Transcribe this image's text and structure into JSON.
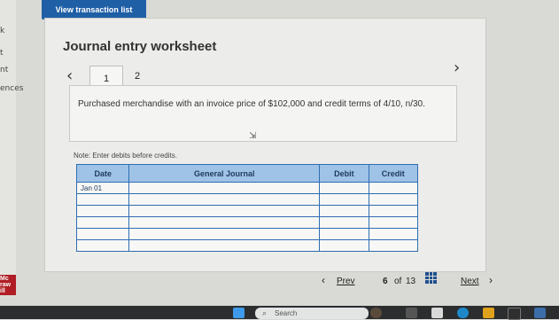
{
  "left_strip": {
    "items": [
      "k",
      "t",
      "nt",
      "ences"
    ]
  },
  "header": {
    "view_transaction_label": "View transaction list"
  },
  "worksheet": {
    "title": "Journal entry worksheet",
    "tabs": [
      {
        "label": "1",
        "active": true
      },
      {
        "label": "2",
        "active": false
      }
    ],
    "prompt": "Purchased merchandise with an invoice price of $102,000 and credit terms of 4/10, n/30.",
    "note": "Note: Enter debits before credits."
  },
  "journal_table": {
    "columns": [
      "Date",
      "General Journal",
      "Debit",
      "Credit"
    ],
    "rows": [
      [
        "Jan 01",
        "",
        "",
        ""
      ],
      [
        "",
        "",
        "",
        ""
      ],
      [
        "",
        "",
        "",
        ""
      ],
      [
        "",
        "",
        "",
        ""
      ],
      [
        "",
        "",
        "",
        ""
      ],
      [
        "",
        "",
        "",
        ""
      ]
    ]
  },
  "pagination": {
    "prev_label": "Prev",
    "current": "6",
    "of_label": "of",
    "total": "13",
    "next_label": "Next"
  },
  "corner_logo": {
    "lines": [
      "Mc",
      "raw",
      "ill"
    ]
  },
  "taskbar": {
    "search_placeholder": "Search"
  },
  "colors": {
    "accent": "#1f5fa6",
    "table_header": "#9fc3e6",
    "table_border": "#2f6db3"
  }
}
